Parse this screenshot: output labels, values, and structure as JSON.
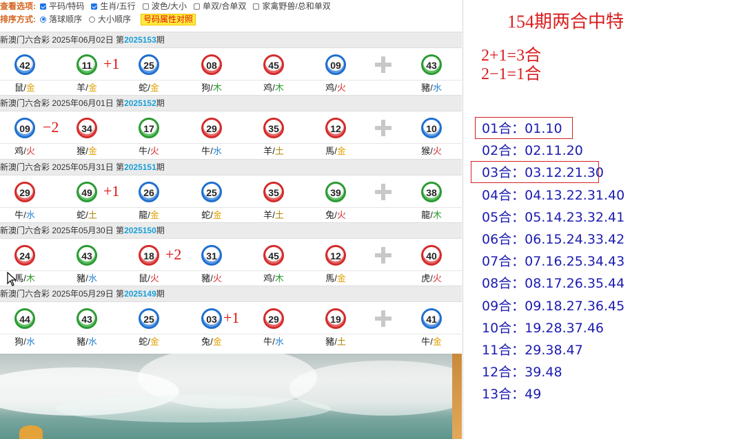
{
  "options": {
    "view_label": "查看选项:",
    "view_opts": [
      {
        "label": "平码/特码",
        "checked": true
      },
      {
        "label": "生肖/五行",
        "checked": true
      },
      {
        "label": "波色/大小",
        "checked": false
      },
      {
        "label": "单双/合单双",
        "checked": false
      },
      {
        "label": "家禽野兽/总和单双",
        "checked": false
      }
    ],
    "sort_label": "排序方式:",
    "sort_opts": [
      {
        "label": "落球顺序",
        "selected": true
      },
      {
        "label": "大小顺序",
        "selected": false
      }
    ],
    "attr_button": "号码属性对照"
  },
  "draws": [
    {
      "prefix": "新澳门六合彩 2025年06月02日 第",
      "issue": "2025153",
      "suffix": "期",
      "balls": [
        {
          "num": "42",
          "color": "blue",
          "zodiac": "鼠",
          "element": "金"
        },
        {
          "num": "11",
          "color": "green",
          "zodiac": "羊",
          "element": "金"
        },
        {
          "num": "25",
          "color": "blue",
          "zodiac": "蛇",
          "element": "金"
        },
        {
          "num": "08",
          "color": "red",
          "zodiac": "狗",
          "element": "木"
        },
        {
          "num": "45",
          "color": "red",
          "zodiac": "鸡",
          "element": "木"
        },
        {
          "num": "09",
          "color": "blue",
          "zodiac": "鸡",
          "element": "火"
        },
        {
          "num": "43",
          "color": "green",
          "zodiac": "豬",
          "element": "水"
        }
      ],
      "mark": {
        "text": "+1",
        "after": 1
      }
    },
    {
      "prefix": "新澳门六合彩 2025年06月01日 第",
      "issue": "2025152",
      "suffix": "期",
      "balls": [
        {
          "num": "09",
          "color": "blue",
          "zodiac": "鸡",
          "element": "火"
        },
        {
          "num": "34",
          "color": "red",
          "zodiac": "猴",
          "element": "金"
        },
        {
          "num": "17",
          "color": "green",
          "zodiac": "牛",
          "element": "火"
        },
        {
          "num": "29",
          "color": "red",
          "zodiac": "牛",
          "element": "水"
        },
        {
          "num": "35",
          "color": "red",
          "zodiac": "羊",
          "element": "土"
        },
        {
          "num": "12",
          "color": "red",
          "zodiac": "馬",
          "element": "金"
        },
        {
          "num": "10",
          "color": "blue",
          "zodiac": "猴",
          "element": "火"
        }
      ],
      "mark": {
        "text": "−2",
        "after": 0
      }
    },
    {
      "prefix": "新澳门六合彩 2025年05月31日 第",
      "issue": "2025151",
      "suffix": "期",
      "balls": [
        {
          "num": "29",
          "color": "red",
          "zodiac": "牛",
          "element": "水"
        },
        {
          "num": "49",
          "color": "green",
          "zodiac": "蛇",
          "element": "土"
        },
        {
          "num": "26",
          "color": "blue",
          "zodiac": "龍",
          "element": "金"
        },
        {
          "num": "25",
          "color": "blue",
          "zodiac": "蛇",
          "element": "金"
        },
        {
          "num": "35",
          "color": "red",
          "zodiac": "羊",
          "element": "土"
        },
        {
          "num": "39",
          "color": "green",
          "zodiac": "兔",
          "element": "火"
        },
        {
          "num": "38",
          "color": "green",
          "zodiac": "龍",
          "element": "木"
        }
      ],
      "mark": {
        "text": "+1",
        "after": 1
      }
    },
    {
      "prefix": "新澳门六合彩 2025年05月30日 第",
      "issue": "2025150",
      "suffix": "期",
      "balls": [
        {
          "num": "24",
          "color": "red",
          "zodiac": "馬",
          "element": "木"
        },
        {
          "num": "43",
          "color": "green",
          "zodiac": "豬",
          "element": "水"
        },
        {
          "num": "18",
          "color": "red",
          "zodiac": "鼠",
          "element": "火"
        },
        {
          "num": "31",
          "color": "blue",
          "zodiac": "豬",
          "element": "火"
        },
        {
          "num": "45",
          "color": "red",
          "zodiac": "鸡",
          "element": "木"
        },
        {
          "num": "12",
          "color": "red",
          "zodiac": "馬",
          "element": "金"
        },
        {
          "num": "40",
          "color": "red",
          "zodiac": "虎",
          "element": "火"
        }
      ],
      "mark": {
        "text": "+2",
        "after": 2
      }
    },
    {
      "prefix": "新澳门六合彩 2025年05月29日 第",
      "issue": "2025149",
      "suffix": "期",
      "balls": [
        {
          "num": "44",
          "color": "green",
          "zodiac": "狗",
          "element": "水"
        },
        {
          "num": "43",
          "color": "green",
          "zodiac": "豬",
          "element": "水"
        },
        {
          "num": "25",
          "color": "blue",
          "zodiac": "蛇",
          "element": "金"
        },
        {
          "num": "03",
          "color": "blue",
          "zodiac": "兔",
          "element": "金"
        },
        {
          "num": "29",
          "color": "red",
          "zodiac": "牛",
          "element": "水"
        },
        {
          "num": "19",
          "color": "red",
          "zodiac": "豬",
          "element": "土"
        },
        {
          "num": "41",
          "color": "blue",
          "zodiac": "牛",
          "element": "金"
        }
      ],
      "mark": {
        "text": "+1",
        "after": 3
      }
    }
  ],
  "right": {
    "title": "154期两合中特",
    "formulas": [
      "2+1=3合",
      "2−1=1合"
    ],
    "combos": [
      {
        "label": "01合：01.10",
        "boxed": true
      },
      {
        "label": "02合：02.11.20",
        "boxed": false
      },
      {
        "label": "03合：03.12.21.30",
        "boxed": true
      },
      {
        "label": "04合：04.13.22.31.40",
        "boxed": false
      },
      {
        "label": "05合：05.14.23.32.41",
        "boxed": false
      },
      {
        "label": "06合：06.15.24.33.42",
        "boxed": false
      },
      {
        "label": "07合：07.16.25.34.43",
        "boxed": false
      },
      {
        "label": "08合：08.17.26.35.44",
        "boxed": false
      },
      {
        "label": "09合：09.18.27.36.45",
        "boxed": false
      },
      {
        "label": "10合：19.28.37.46",
        "boxed": false
      },
      {
        "label": "11合：29.38.47",
        "boxed": false
      },
      {
        "label": "12合：39.48",
        "boxed": false
      },
      {
        "label": "13合：49",
        "boxed": false
      }
    ]
  },
  "colors": {
    "red_ball": "#d42b2b",
    "blue_ball": "#1f6fce",
    "green_ball": "#2b9a33",
    "issue_number": "#1a9fd6",
    "option_title": "#d4621c",
    "handwriting": "#dd1111",
    "combo_text": "#1b1bb0"
  }
}
